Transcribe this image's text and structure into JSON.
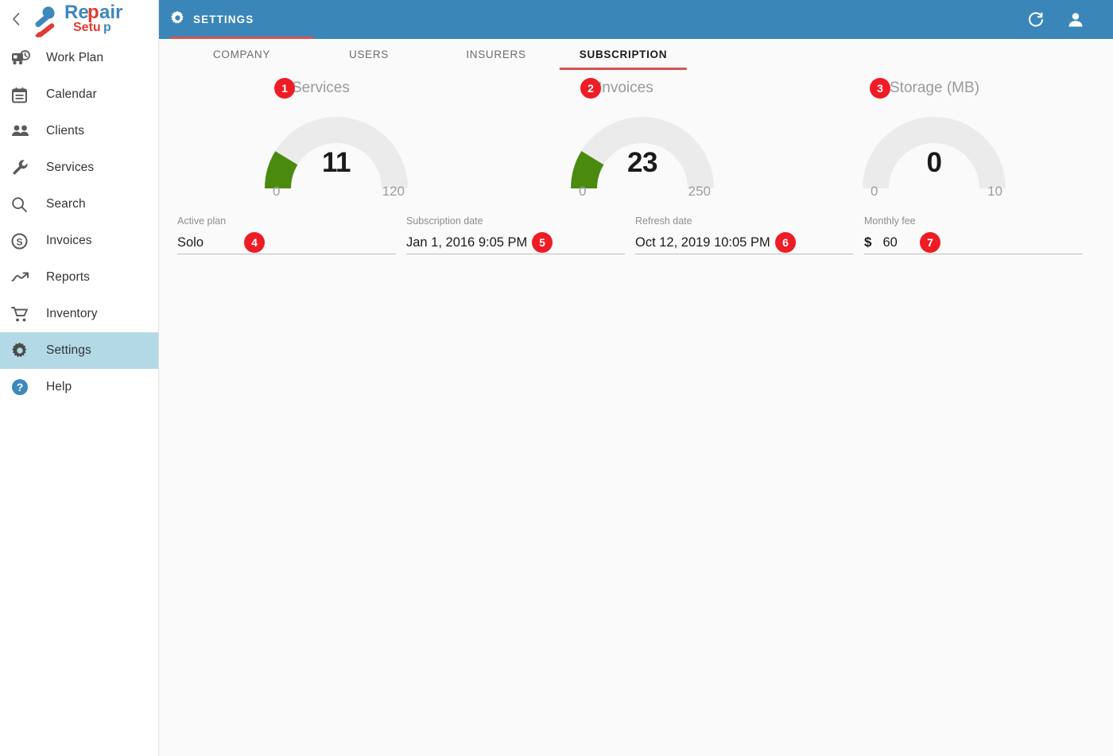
{
  "sidebar": {
    "collapse_icon": "chevron-left-icon",
    "logo": {
      "icon": "wrench-screwdriver-icon",
      "text_primary": "Repair",
      "text_secondary": "Setup"
    },
    "items": [
      {
        "label": "Work Plan",
        "icon": "work-plan-icon",
        "active": false
      },
      {
        "label": "Calendar",
        "icon": "calendar-icon",
        "active": false
      },
      {
        "label": "Clients",
        "icon": "clients-icon",
        "active": false
      },
      {
        "label": "Services",
        "icon": "wrench-icon",
        "active": false
      },
      {
        "label": "Search",
        "icon": "search-icon",
        "active": false
      },
      {
        "label": "Invoices",
        "icon": "dollar-circle-icon",
        "active": false
      },
      {
        "label": "Reports",
        "icon": "trending-up-icon",
        "active": false
      },
      {
        "label": "Inventory",
        "icon": "cart-icon",
        "active": false
      },
      {
        "label": "Settings",
        "icon": "gear-icon",
        "active": true
      },
      {
        "label": "Help",
        "icon": "help-circle-icon",
        "active": false
      }
    ]
  },
  "topbar": {
    "title": "SETTINGS",
    "title_icon": "gear-icon",
    "refresh_icon": "refresh-icon",
    "account_icon": "person-icon",
    "background": "#3a86b8",
    "accent": "#d9534f"
  },
  "tabs": [
    {
      "label": "COMPANY",
      "active": false
    },
    {
      "label": "USERS",
      "active": false
    },
    {
      "label": "INSURERS",
      "active": false
    },
    {
      "label": "SUBSCRIPTION",
      "active": true
    }
  ],
  "gauges": [
    {
      "badge": "1",
      "title": "Services",
      "value": "11",
      "min": "0",
      "max": "120",
      "fill_fraction": 0.0917
    },
    {
      "badge": "2",
      "title": "Invoices",
      "value": "23",
      "min": "0",
      "max": "250",
      "fill_fraction": 0.092
    },
    {
      "badge": "3",
      "title": "Storage (MB)",
      "value": "0",
      "min": "0",
      "max": "10",
      "fill_fraction": 0
    }
  ],
  "fields": [
    {
      "badge": "4",
      "label": "Active plan",
      "value": "Solo",
      "prefix": ""
    },
    {
      "badge": "5",
      "label": "Subscription date",
      "value": "Jan 1, 2016 9:05 PM",
      "prefix": ""
    },
    {
      "badge": "6",
      "label": "Refresh date",
      "value": "Oct 12, 2019 10:05 PM",
      "prefix": ""
    },
    {
      "badge": "7",
      "label": "Monthly fee",
      "value": "60",
      "prefix": "$"
    }
  ],
  "colors": {
    "gauge_track": "#ebebeb",
    "gauge_fill": "#4a8a0f",
    "badge_red": "#ee1c25",
    "sidebar_active": "#b3d9e6"
  }
}
